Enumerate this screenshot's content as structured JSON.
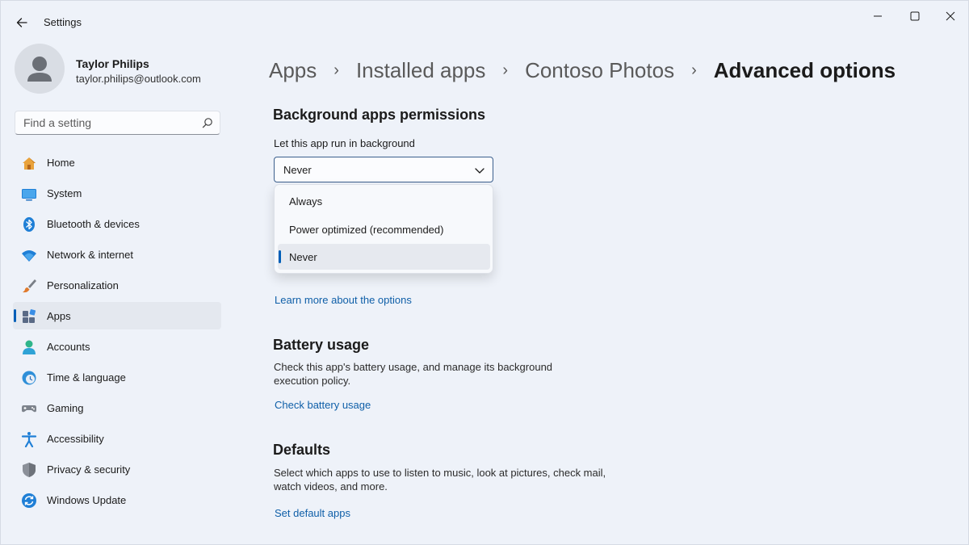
{
  "window": {
    "title": "Settings"
  },
  "user": {
    "name": "Taylor Philips",
    "email": "taylor.philips@outlook.com"
  },
  "search": {
    "placeholder": "Find a setting"
  },
  "nav": {
    "items": [
      {
        "label": "Home",
        "icon": "home-icon"
      },
      {
        "label": "System",
        "icon": "system-icon"
      },
      {
        "label": "Bluetooth & devices",
        "icon": "bluetooth-icon"
      },
      {
        "label": "Network & internet",
        "icon": "wifi-icon"
      },
      {
        "label": "Personalization",
        "icon": "brush-icon"
      },
      {
        "label": "Apps",
        "icon": "apps-icon",
        "active": true
      },
      {
        "label": "Accounts",
        "icon": "person-icon"
      },
      {
        "label": "Time & language",
        "icon": "clock-globe-icon"
      },
      {
        "label": "Gaming",
        "icon": "gamepad-icon"
      },
      {
        "label": "Accessibility",
        "icon": "accessibility-icon"
      },
      {
        "label": "Privacy & security",
        "icon": "shield-icon"
      },
      {
        "label": "Windows Update",
        "icon": "update-icon"
      }
    ]
  },
  "breadcrumb": {
    "items": [
      "Apps",
      "Installed apps",
      "Contoso Photos",
      "Advanced options"
    ],
    "separator": "›"
  },
  "background_apps": {
    "heading": "Background apps permissions",
    "label": "Let this app run in background",
    "selected": "Never",
    "options": [
      "Always",
      "Power optimized (recommended)",
      "Never"
    ],
    "learn_more": "Learn more about the options"
  },
  "battery": {
    "heading": "Battery usage",
    "description": "Check this app's battery usage, and manage its background execution policy.",
    "link": "Check battery usage"
  },
  "defaults": {
    "heading": "Defaults",
    "description": "Select which apps to use to listen to music, look at pictures, check mail, watch videos, and more.",
    "link": "Set default apps"
  },
  "colors": {
    "accent": "#005fb8",
    "link": "#0f5fa8",
    "background": "#eef2f9"
  }
}
